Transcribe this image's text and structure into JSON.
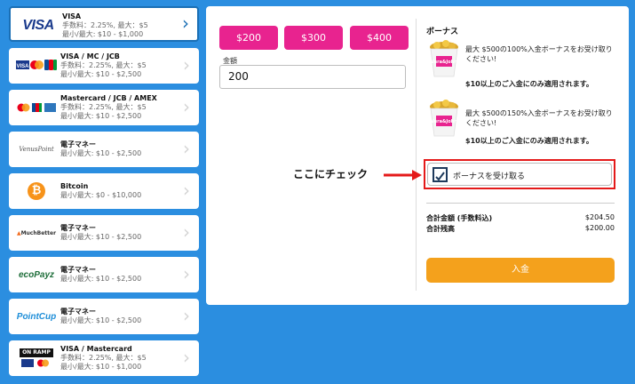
{
  "payment_methods": [
    {
      "title": "VISA",
      "lines": [
        "手数料：2.25%, 最大：$5",
        "最小/最大: $10 - $1,000"
      ],
      "logo": "visa-logo",
      "logo_text": "VISA",
      "selected": true
    },
    {
      "title": "VISA / MC / JCB",
      "lines": [
        "手数料：2.25%, 最大：$5",
        "最小/最大: $10 - $2,500"
      ],
      "logo": "visa-mc-jcb-logo",
      "logo_text": "VISA JCB"
    },
    {
      "title": "Mastercard / JCB / AMEX",
      "lines": [
        "手数料：2.25%, 最大：$5",
        "最小/最大: $10 - $2,500"
      ],
      "logo": "mc-jcb-amex-logo",
      "logo_text": ""
    },
    {
      "title": "電子マネー",
      "lines": [
        "最小/最大: $10 - $2,500"
      ],
      "logo": "venus-point-logo",
      "logo_text": "VenusPoint"
    },
    {
      "title": "Bitcoin",
      "lines": [
        "最小/最大: $0 - $10,000"
      ],
      "logo": "bitcoin-logo",
      "logo_text": "₿"
    },
    {
      "title": "電子マネー",
      "lines": [
        "最小/最大: $10 - $2,500"
      ],
      "logo": "muchbetter-logo",
      "logo_text": "MuchBetter"
    },
    {
      "title": "電子マネー",
      "lines": [
        "最小/最大: $10 - $2,500"
      ],
      "logo": "ecopayz-logo",
      "logo_text": "ecoPayz"
    },
    {
      "title": "電子マネー",
      "lines": [
        "最小/最大: $10 - $2,500"
      ],
      "logo": "pointcup-logo",
      "logo_text": "PointCup"
    },
    {
      "title": "VISA / Mastercard",
      "lines": [
        "手数料：2.25%, 最大：$5",
        "最小/最大: $10 - $1,000"
      ],
      "logo": "onramp-logo",
      "logo_text": "ON RAMP"
    }
  ],
  "amount_buttons": [
    "$200",
    "$300",
    "$400"
  ],
  "amount": {
    "label": "金額",
    "value": "200"
  },
  "bonus": {
    "title": "ボーナス",
    "offers": [
      {
        "text": "最大 $500の100%入金ボーナスをお受け取りください!",
        "min": "$10以上のご入金にのみ適用されます。",
        "image": "vera-john-coins-image",
        "image_text": "Vera&John"
      },
      {
        "text": "最大 $500の150%入金ボーナスをお受け取りください!",
        "min": "$10以上のご入金にのみ適用されます。",
        "image": "vera-john-coins-image",
        "image_text": "Vera&John"
      }
    ],
    "checkbox_label": "ボーナスを受け取る",
    "checked": true
  },
  "annotation": "ここにチェック",
  "summary": {
    "total_label": "合計金額 (手数料込)",
    "total_value": "$204.50",
    "balance_label": "合計残高",
    "balance_value": "$200.00"
  },
  "deposit_button": "入金",
  "colors": {
    "background": "#2b8ee0",
    "amount_button": "#e8238f",
    "deposit_button": "#f4a11c",
    "highlight": "#e41a1a",
    "selected_border": "#1a6fb5"
  }
}
